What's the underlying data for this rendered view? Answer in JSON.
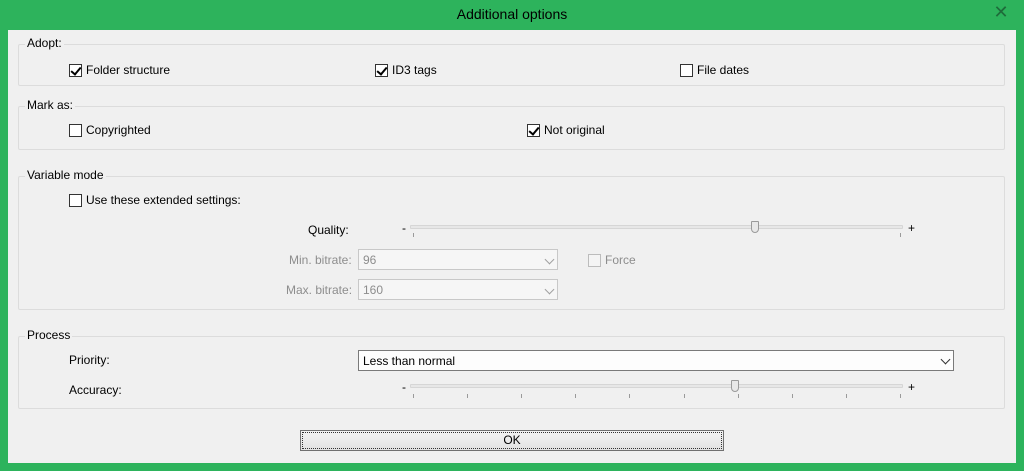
{
  "window": {
    "title": "Additional options",
    "close_symbol": "✕"
  },
  "adopt": {
    "legend": "Adopt:",
    "folder_structure": {
      "label": "Folder structure",
      "checked": true
    },
    "id3_tags": {
      "label": "ID3 tags",
      "checked": true
    },
    "file_dates": {
      "label": "File dates",
      "checked": false
    }
  },
  "mark_as": {
    "legend": "Mark as:",
    "copyrighted": {
      "label": "Copyrighted",
      "checked": false
    },
    "not_original": {
      "label": "Not original",
      "checked": true
    }
  },
  "variable_mode": {
    "legend": "Variable mode",
    "use_extended": {
      "label": "Use these extended settings:",
      "checked": false
    },
    "quality": {
      "label": "Quality:",
      "minus": "-",
      "plus": "+",
      "value_fraction": 0.7
    },
    "min_bitrate": {
      "label": "Min. bitrate:",
      "value": "96"
    },
    "force": {
      "label": "Force",
      "checked": false
    },
    "max_bitrate": {
      "label": "Max. bitrate:",
      "value": "160"
    }
  },
  "process": {
    "legend": "Process",
    "priority": {
      "label": "Priority:",
      "value": "Less than normal"
    },
    "accuracy": {
      "label": "Accuracy:",
      "minus": "-",
      "plus": "+",
      "value_fraction": 0.66,
      "tick_count": 10
    }
  },
  "ok_label": "OK",
  "icons": {
    "checkbox": "checkmark-icon",
    "dropdown": "chevron-down-icon",
    "close": "close-icon"
  }
}
